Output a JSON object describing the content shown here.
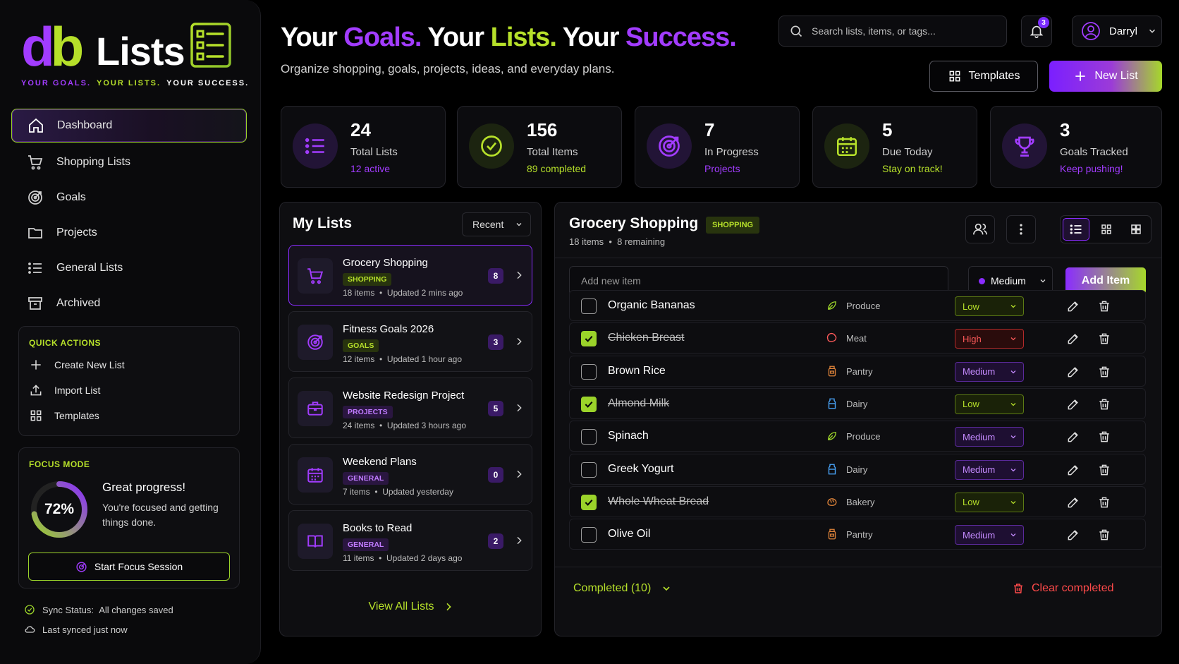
{
  "logo": {
    "db_d": "d",
    "db_b": "b",
    "lists": "Lists",
    "tag1": "YOUR GOALS.",
    "tag2": "YOUR LISTS.",
    "tag3": "YOUR SUCCESS."
  },
  "nav": [
    {
      "label": "Dashboard",
      "icon": "home-icon"
    },
    {
      "label": "Shopping Lists",
      "icon": "cart-icon"
    },
    {
      "label": "Goals",
      "icon": "target-icon"
    },
    {
      "label": "Projects",
      "icon": "folder-icon"
    },
    {
      "label": "General Lists",
      "icon": "list-icon"
    },
    {
      "label": "Archived",
      "icon": "archive-icon"
    }
  ],
  "quick_actions": {
    "title": "QUICK ACTIONS",
    "items": [
      {
        "label": "Create New List",
        "icon": "plus-icon"
      },
      {
        "label": "Import List",
        "icon": "upload-icon"
      },
      {
        "label": "Templates",
        "icon": "grid-icon"
      }
    ]
  },
  "focus": {
    "title": "FOCUS MODE",
    "percent_label": "72%",
    "percent": 72,
    "heading": "Great progress!",
    "desc": "You're focused and getting things done.",
    "button": "Start Focus Session"
  },
  "sync": {
    "label": "Sync Status:",
    "value": "All changes saved",
    "last": "Last synced just now"
  },
  "header": {
    "h1": "Your ",
    "h2": "Goals.",
    "h3": " Your ",
    "h4": "Lists.",
    "h5": " Your ",
    "h6": "Success.",
    "subtitle": "Organize shopping, goals, projects, ideas, and everyday plans.",
    "search_placeholder": "Search lists, items, or tags...",
    "notifications": "3",
    "user": "Darryl",
    "templates_btn": "Templates",
    "new_list_btn": "New List"
  },
  "stats": [
    {
      "value": "24",
      "label": "Total Lists",
      "sub": "12 active",
      "icon": "list-icon"
    },
    {
      "value": "156",
      "label": "Total Items",
      "sub": "89 completed",
      "icon": "check-circle-icon"
    },
    {
      "value": "7",
      "label": "In Progress",
      "sub": "Projects",
      "icon": "target-icon"
    },
    {
      "value": "5",
      "label": "Due Today",
      "sub": "Stay on track!",
      "icon": "calendar-icon"
    },
    {
      "value": "3",
      "label": "Goals Tracked",
      "sub": "Keep pushing!",
      "icon": "trophy-icon"
    }
  ],
  "my_lists": {
    "title": "My Lists",
    "sort": "Recent",
    "items": [
      {
        "title": "Grocery Shopping",
        "tag": "SHOPPING",
        "items": "18 items",
        "updated": "Updated 2 mins ago",
        "count": "8",
        "icon": "cart-icon"
      },
      {
        "title": "Fitness Goals 2026",
        "tag": "GOALS",
        "items": "12 items",
        "updated": "Updated 1 hour ago",
        "count": "3",
        "icon": "target-icon"
      },
      {
        "title": "Website Redesign Project",
        "tag": "PROJECTS",
        "items": "24 items",
        "updated": "Updated 3 hours ago",
        "count": "5",
        "icon": "briefcase-icon"
      },
      {
        "title": "Weekend Plans",
        "tag": "GENERAL",
        "items": "7 items",
        "updated": "Updated yesterday",
        "count": "0",
        "icon": "calendar-icon"
      },
      {
        "title": "Books to Read",
        "tag": "GENERAL",
        "items": "11 items",
        "updated": "Updated 2 days ago",
        "count": "2",
        "icon": "book-icon"
      }
    ],
    "view_all": "View All Lists"
  },
  "grocery": {
    "title": "Grocery Shopping",
    "tag": "SHOPPING",
    "meta_items": "18 items",
    "meta_remaining": "8 remaining",
    "add_placeholder": "Add new item",
    "priority": "Medium",
    "add_btn": "Add Item",
    "items": [
      {
        "name": "Organic Bananas",
        "done": false,
        "category": "Produce",
        "priority": "Low"
      },
      {
        "name": "Chicken Breast",
        "done": true,
        "category": "Meat",
        "priority": "High"
      },
      {
        "name": "Brown Rice",
        "done": false,
        "category": "Pantry",
        "priority": "Medium"
      },
      {
        "name": "Almond Milk",
        "done": true,
        "category": "Dairy",
        "priority": "Low"
      },
      {
        "name": "Spinach",
        "done": false,
        "category": "Produce",
        "priority": "Medium"
      },
      {
        "name": "Greek Yogurt",
        "done": false,
        "category": "Dairy",
        "priority": "Medium"
      },
      {
        "name": "Whole Wheat Bread",
        "done": true,
        "category": "Bakery",
        "priority": "Low"
      },
      {
        "name": "Olive Oil",
        "done": false,
        "category": "Pantry",
        "priority": "Medium"
      }
    ],
    "completed": "Completed (10)",
    "clear": "Clear completed"
  },
  "colors": {
    "accent_purple": "#a23cff",
    "accent_lime": "#b6e02a",
    "danger": "#ff4a4a",
    "bg": "#000000"
  }
}
